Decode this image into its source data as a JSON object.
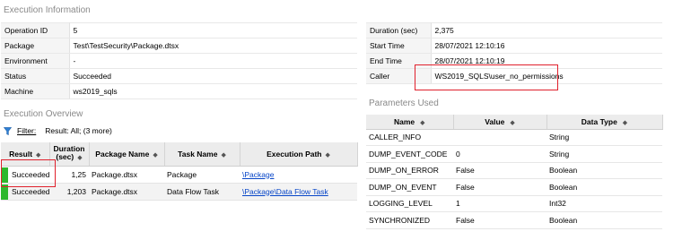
{
  "execution_info": {
    "title": "Execution Information",
    "rows": [
      {
        "label": "Operation ID",
        "value": "5"
      },
      {
        "label": "Package",
        "value": "Test\\TestSecurity\\Package.dtsx"
      },
      {
        "label": "Environment",
        "value": "-"
      },
      {
        "label": "Status",
        "value": "Succeeded"
      },
      {
        "label": "Machine",
        "value": "ws2019_sqls"
      }
    ]
  },
  "timing_info": {
    "rows": [
      {
        "label": "Duration (sec)",
        "value": "2,375"
      },
      {
        "label": "Start Time",
        "value": "28/07/2021 12:10:16"
      },
      {
        "label": "End Time",
        "value": "28/07/2021 12:10:19"
      },
      {
        "label": "Caller",
        "value": "WS2019_SQLS\\user_no_permissions"
      }
    ]
  },
  "overview": {
    "title": "Execution Overview",
    "filter_label": "Filter:",
    "filter_text": "Result: All;  (3 more)",
    "columns": [
      "Result",
      "Duration (sec)",
      "Package Name",
      "Task Name",
      "Execution Path"
    ],
    "rows": [
      {
        "result": "Succeeded",
        "duration": "1,25",
        "package": "Package.dtsx",
        "task": "Package",
        "path": "\\Package"
      },
      {
        "result": "Succeeded",
        "duration": "1,203",
        "package": "Package.dtsx",
        "task": "Data Flow Task",
        "path": "\\Package\\Data Flow Task"
      }
    ],
    "status_color": "#2db82d"
  },
  "parameters": {
    "title": "Parameters Used",
    "columns": [
      "Name",
      "Value",
      "Data Type"
    ],
    "rows": [
      {
        "name": "CALLER_INFO",
        "value": "",
        "type": "String"
      },
      {
        "name": "DUMP_EVENT_CODE",
        "value": "0",
        "type": "String"
      },
      {
        "name": "DUMP_ON_ERROR",
        "value": "False",
        "type": "Boolean"
      },
      {
        "name": "DUMP_ON_EVENT",
        "value": "False",
        "type": "Boolean"
      },
      {
        "name": "LOGGING_LEVEL",
        "value": "1",
        "type": "Int32"
      },
      {
        "name": "SYNCHRONIZED",
        "value": "False",
        "type": "Boolean"
      }
    ]
  },
  "highlight_color": "#e0202c",
  "link_color": "#0645c8"
}
